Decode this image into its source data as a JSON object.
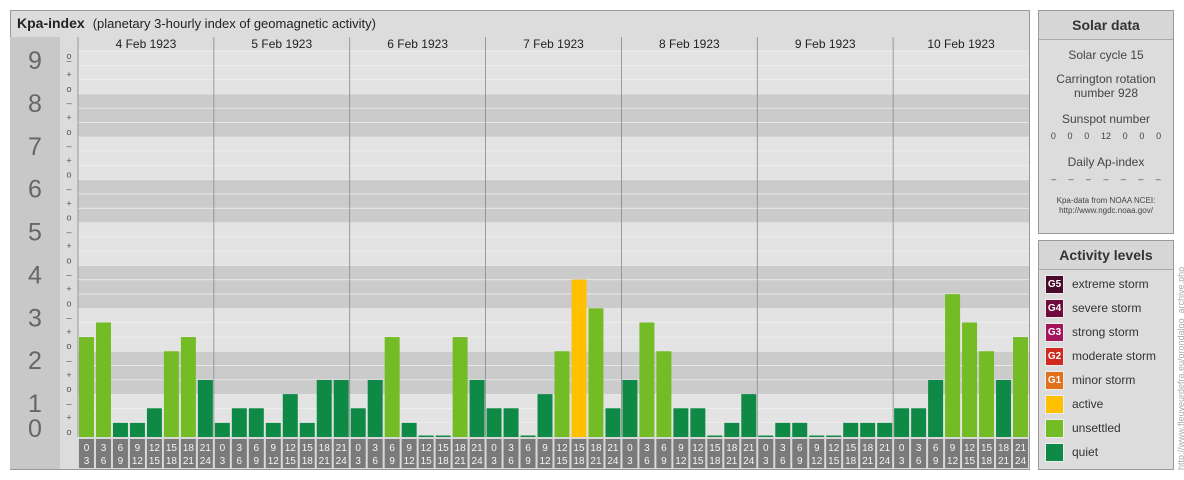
{
  "header": {
    "title": "Kpa-index",
    "subtitle": "(planetary 3-hourly index of geomagnetic activity)"
  },
  "chart_data": {
    "type": "bar",
    "ylim": [
      0,
      9
    ],
    "y_ticks": [
      "0",
      "1",
      "2",
      "3",
      "4",
      "5",
      "6",
      "7",
      "8",
      "9"
    ],
    "minor_tick_marks": [
      "o",
      "+",
      "–"
    ],
    "days": [
      "4 Feb 1923",
      "5 Feb 1923",
      "6 Feb 1923",
      "7 Feb 1923",
      "8 Feb 1923",
      "9 Feb 1923",
      "10 Feb 1923"
    ],
    "interval_labels": [
      [
        "0",
        "3"
      ],
      [
        "3",
        "6"
      ],
      [
        "6",
        "9"
      ],
      [
        "9",
        "12"
      ],
      [
        "12",
        "15"
      ],
      [
        "15",
        "18"
      ],
      [
        "18",
        "21"
      ],
      [
        "21",
        "24"
      ]
    ],
    "values": [
      2.33,
      2.67,
      0.33,
      0.33,
      0.67,
      2.0,
      2.33,
      1.33,
      0.33,
      0.67,
      0.67,
      0.33,
      1.0,
      0.33,
      1.33,
      1.33,
      0.67,
      1.33,
      2.33,
      0.33,
      0.0,
      0.0,
      2.33,
      1.33,
      0.67,
      0.67,
      0.0,
      1.0,
      2.0,
      3.67,
      3.0,
      0.67,
      1.33,
      2.67,
      2.0,
      0.67,
      0.67,
      0.0,
      0.33,
      1.0,
      0.0,
      0.33,
      0.33,
      0.0,
      0.0,
      0.33,
      0.33,
      0.33,
      0.67,
      0.67,
      1.33,
      3.33,
      2.67,
      2.0,
      1.33,
      2.33
    ],
    "level_colors": {
      "quiet": "#0e8a46",
      "unsettled": "#74bc26",
      "active": "#ffc000"
    }
  },
  "solar": {
    "heading": "Solar data",
    "cycle": "Solar cycle 15",
    "carrington": "Carrington rotation number 928",
    "sunspot_heading": "Sunspot number",
    "sunspots": [
      "0",
      "0",
      "0",
      "12",
      "0",
      "0",
      "0"
    ],
    "ap_heading": "Daily Ap-index",
    "ap_values": [
      "–",
      "–",
      "–",
      "–",
      "–",
      "–",
      "–"
    ],
    "credit_line1": "Kpa-data from NOAA NCEI:",
    "credit_line2": "http://www.ngdc.noaa.gov/"
  },
  "levels": {
    "heading": "Activity levels",
    "items": [
      {
        "badge": "G5",
        "label": "extreme storm",
        "color": "#4a0a2a"
      },
      {
        "badge": "G4",
        "label": "severe storm",
        "color": "#6e0d3c"
      },
      {
        "badge": "G3",
        "label": "strong storm",
        "color": "#a3145a"
      },
      {
        "badge": "G2",
        "label": "moderate storm",
        "color": "#d02a1e"
      },
      {
        "badge": "G1",
        "label": "minor storm",
        "color": "#e0701a"
      },
      {
        "badge": "",
        "label": "active",
        "color": "#ffc000"
      },
      {
        "badge": "",
        "label": "unsettled",
        "color": "#74bc26"
      },
      {
        "badge": "",
        "label": "quiet",
        "color": "#0e8a46"
      }
    ]
  },
  "watermark": "http://www.fleuveurdefra.eu/grondalgo_archive.php"
}
